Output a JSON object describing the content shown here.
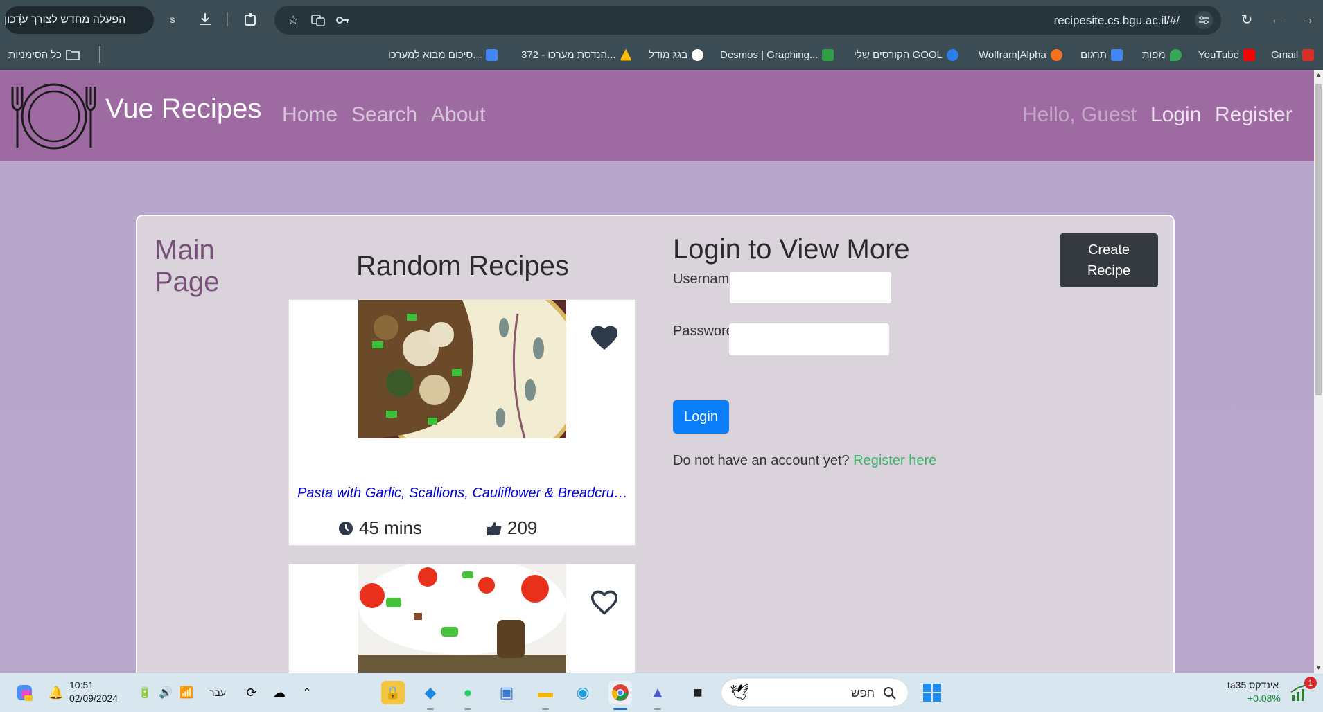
{
  "browser": {
    "update_label": "הפעלה מחדש לצורך עדכון",
    "profile_initial": "s",
    "url": "recipesite.cs.bgu.ac.il/#/"
  },
  "bookmarks": {
    "all_bookmarks": "כל הסימניות",
    "items": [
      {
        "label": "Gmail",
        "icon": "gmail-icon",
        "color": "#d93025"
      },
      {
        "label": "YouTube",
        "icon": "youtube-icon",
        "color": "#ff0000"
      },
      {
        "label": "מפות",
        "icon": "maps-icon",
        "color": "#34a853"
      },
      {
        "label": "תרגום",
        "icon": "translate-icon",
        "color": "#4285f4"
      },
      {
        "label": "Wolfram|Alpha",
        "icon": "wolfram-icon",
        "color": "#f4721e"
      },
      {
        "label": "הקורסים שלי GOOL",
        "icon": "gool-icon",
        "color": "#2b7de9"
      },
      {
        "label": "Desmos | Graphing...",
        "icon": "desmos-icon",
        "color": "#2f9e44"
      },
      {
        "label": "בגג מודל",
        "icon": "globe-icon",
        "color": "#ffffff"
      },
      {
        "label": "372 - הנדסת מערכו...",
        "icon": "drive-icon",
        "color": "#fbbc04"
      },
      {
        "label": "סיכום מבוא למערכו...",
        "icon": "docs-icon",
        "color": "#4285f4"
      }
    ]
  },
  "nav": {
    "brand": "Vue Recipes",
    "home": "Home",
    "search": "Search",
    "about": "About",
    "hello": "Hello, Guest",
    "login": "Login",
    "register": "Register"
  },
  "main": {
    "page_title": "Main Page",
    "random_title": "Random Recipes",
    "recipes": [
      {
        "name": "Pasta with Garlic, Scallions, Cauliflower & Breadcrumbs",
        "time": "45 mins",
        "likes": "209",
        "favorite": true
      },
      {
        "name": "",
        "time": "",
        "likes": "",
        "favorite": false
      }
    ]
  },
  "login": {
    "title": "Login to View More",
    "username_label": "Username:",
    "username_value": "",
    "password_label": "Password:",
    "password_value": "",
    "button": "Login",
    "no_account": "Do not have an account yet?",
    "register_link": "Register here"
  },
  "create_recipe": "Create Recipe",
  "taskbar": {
    "time": "10:51",
    "date": "02/09/2024",
    "language": "עבר",
    "search_placeholder": "חפש",
    "stock_name": "ta35 אינדקס",
    "stock_change": "+0.08%",
    "notification_count": "1"
  }
}
